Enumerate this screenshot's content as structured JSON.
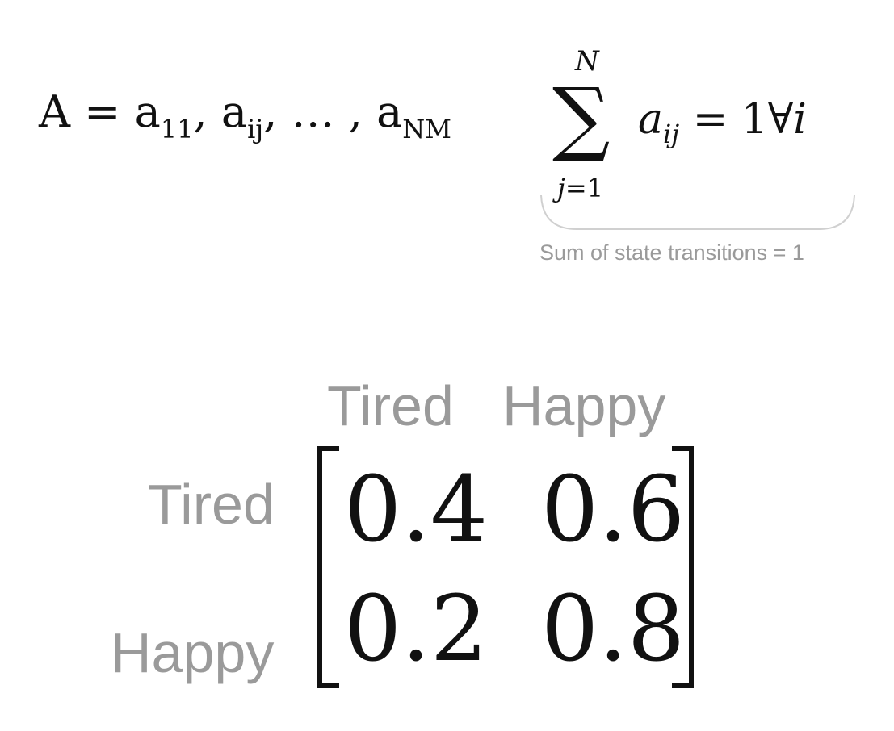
{
  "equation": {
    "lhs": "A",
    "eq": "=",
    "a": "a",
    "sub_11": "11",
    "sub_ij": "ij",
    "ellipsis": "…",
    "sub_nm": "NM",
    "comma": ","
  },
  "sum": {
    "upper": "N",
    "sigma": "∑",
    "lower_var": "j",
    "lower_rest": "=1",
    "term": "a",
    "term_sub": "ij",
    "rhs": "= 1∀",
    "rhs_var": "i",
    "caption": "Sum of state transitions = 1"
  },
  "matrix": {
    "columns": [
      "Tired",
      "Happy"
    ],
    "rows": [
      "Tired",
      "Happy"
    ],
    "values": [
      [
        "0.4",
        "0.6"
      ],
      [
        "0.2",
        "0.8"
      ]
    ]
  },
  "colors": {
    "label_gray": "#9a9a9a",
    "bracket_underline": "#d0d0d0",
    "ink": "#111111"
  }
}
